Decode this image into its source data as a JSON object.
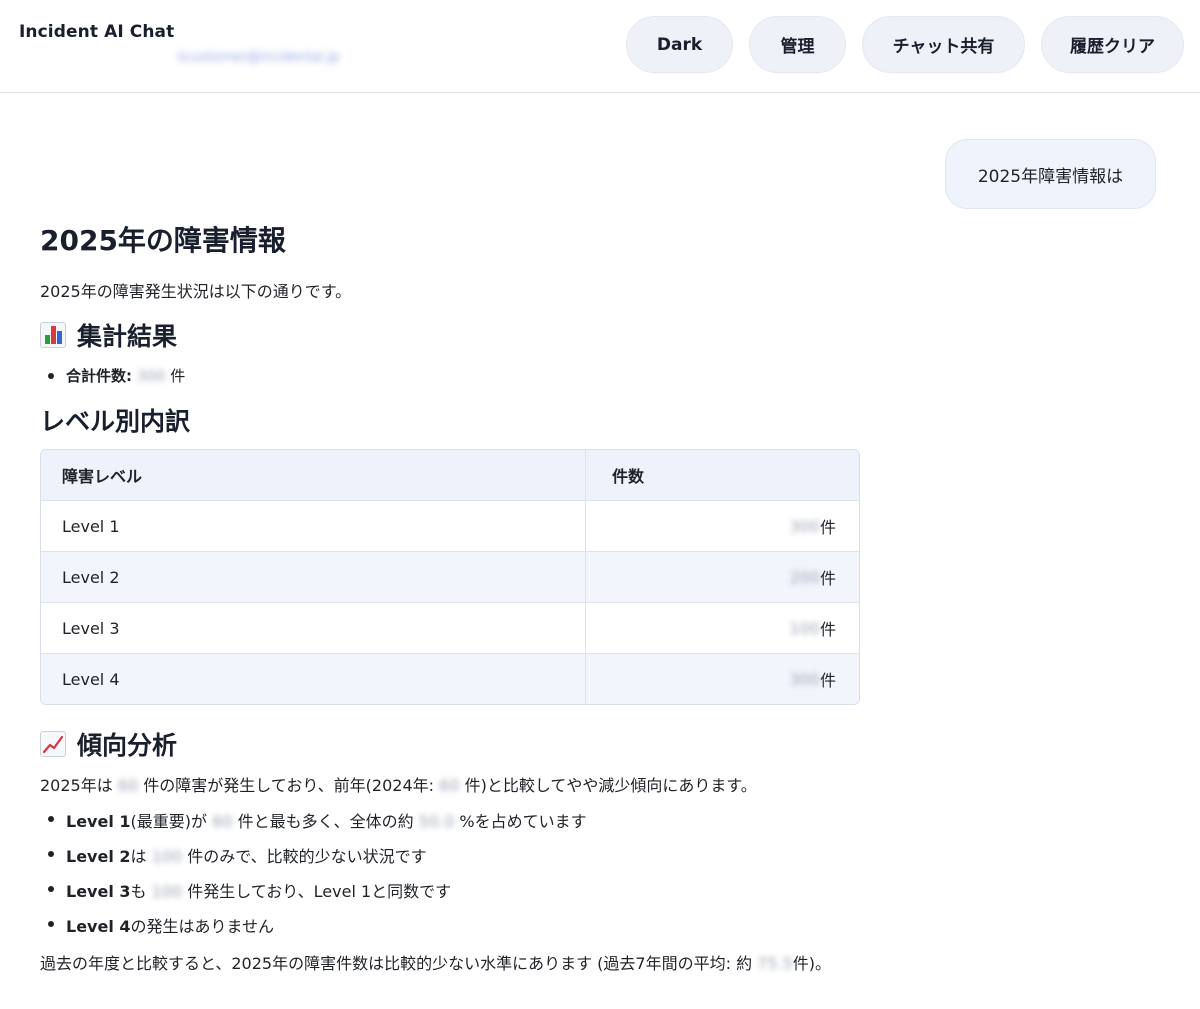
{
  "header": {
    "app_title": "Incident AI Chat",
    "user_email": "kcustomer@incidentai.jp",
    "buttons": {
      "dark": "Dark",
      "admin": "管理",
      "share": "チャット共有",
      "clear": "履歴クリア"
    }
  },
  "user_message": "2025年障害情報は",
  "answer": {
    "title": "2025年の障害情報",
    "intro": "2025年の障害発生状況は以下の通りです。",
    "summary": {
      "heading": "集計結果",
      "icon": "bar-chart-icon",
      "total_label": "合計件数:",
      "total_value": "300",
      "total_unit": "件"
    },
    "level_breakdown": {
      "heading": "レベル別内訳",
      "columns": [
        "障害レベル",
        "件数"
      ],
      "rows": [
        {
          "level": "Level 1",
          "count": "300",
          "unit": "件"
        },
        {
          "level": "Level 2",
          "count": "200",
          "unit": "件"
        },
        {
          "level": "Level 3",
          "count": "100",
          "unit": "件"
        },
        {
          "level": "Level 4",
          "count": "300",
          "unit": "件"
        }
      ]
    },
    "trend": {
      "heading": "傾向分析",
      "icon": "trending-up-icon",
      "text_a": "2025年は",
      "text_count": "60",
      "text_b": "件の障害が発生しており、前年(2024年:",
      "text_prev": "60",
      "text_c": "件)と比較してやや減少傾向にあります。",
      "bullets": [
        {
          "bold": "Level 1",
          "a": "(最重要)が",
          "v1": "60",
          "b": "件と最も多く、全体の約",
          "v2": "50.0",
          "c": "%を占めています"
        },
        {
          "bold": "Level 2",
          "a": "は",
          "v1": "100",
          "b": "件のみで、比較的少ない状況です"
        },
        {
          "bold": "Level 3",
          "a": "も",
          "v1": "100",
          "b": "件発生しており、Level 1と同数です"
        },
        {
          "bold": "Level 4",
          "a": "の発生はありません"
        }
      ]
    },
    "closing": {
      "a": "過去の年度と比較すると、2025年の障害件数は比較的少ない水準にあります (過去7年間の平均: 約",
      "value": "75.5",
      "b": "件)。"
    }
  }
}
